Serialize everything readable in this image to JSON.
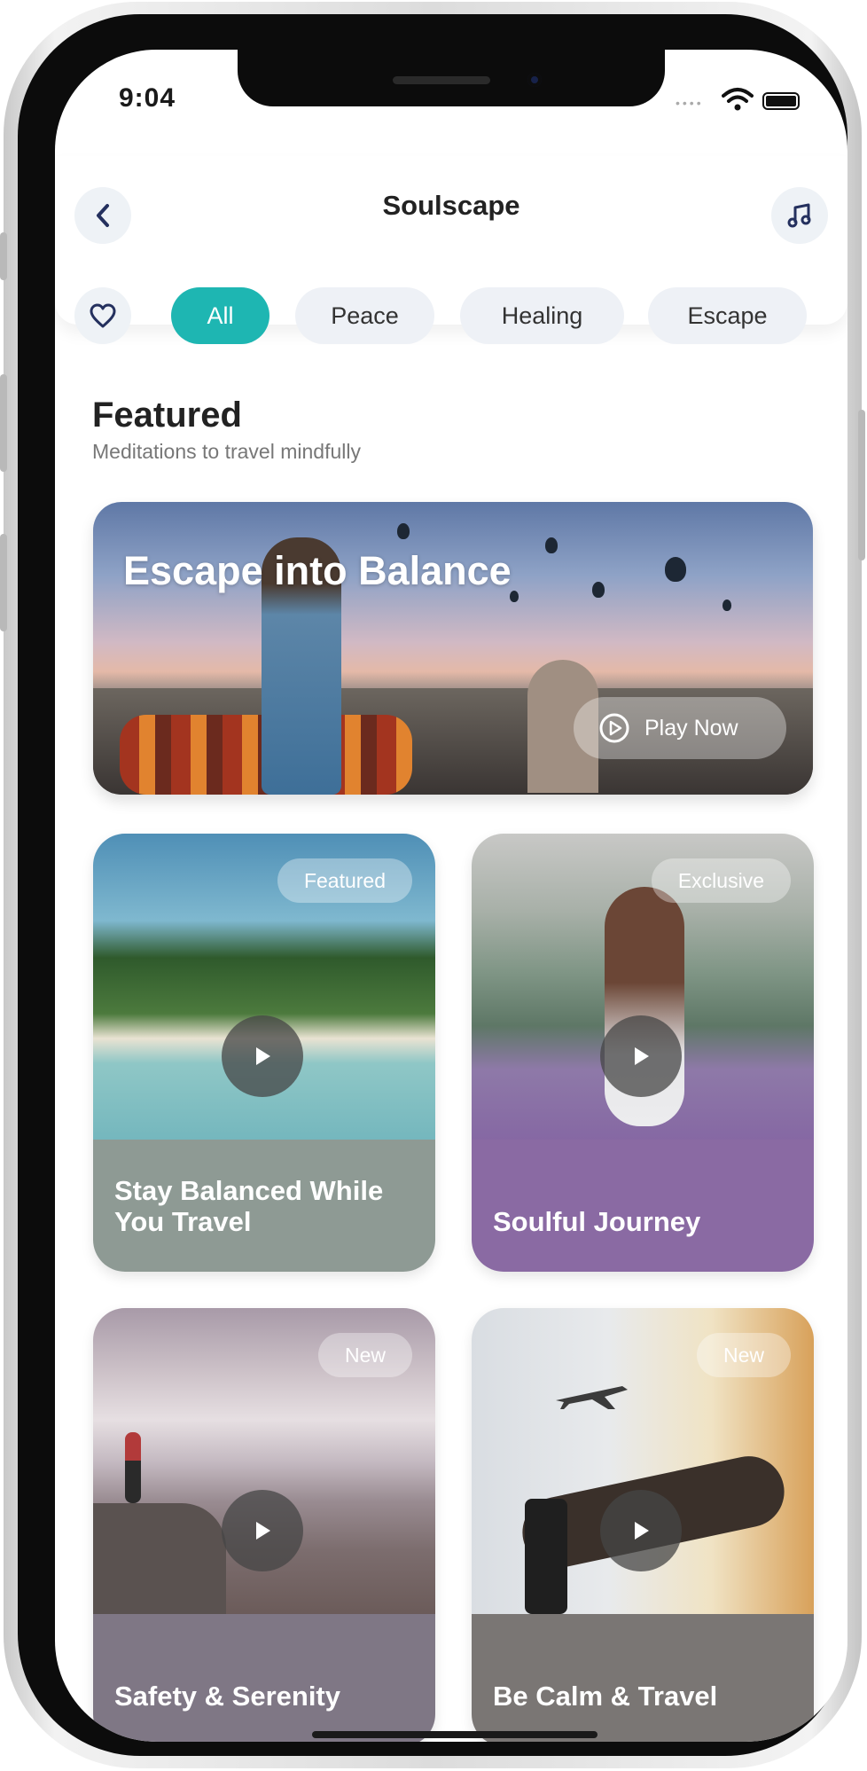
{
  "status": {
    "time": "9:04",
    "signal_dots": "••••"
  },
  "header": {
    "title": "Soulscape",
    "back_icon": "chevron-left-icon",
    "music_icon": "music-note-icon"
  },
  "filters": {
    "favorites_icon": "heart-icon",
    "chips": [
      "All",
      "Peace",
      "Healing",
      "Escape"
    ],
    "selected": "All",
    "accent": "#1eb6b2"
  },
  "section": {
    "title": "Featured",
    "subtitle": "Meditations to travel mindfully"
  },
  "hero": {
    "title": "Escape into Balance",
    "button": "Play Now"
  },
  "cards": [
    {
      "title": "Stay Balanced While You Travel",
      "badge": "Featured",
      "band_color": "#8e9a94"
    },
    {
      "title": "Soulful Journey",
      "badge": "Exclusive",
      "band_color": "#8a6aa3"
    },
    {
      "title": "Safety & Serenity",
      "badge": "New",
      "band_color": "#7f7785"
    },
    {
      "title": "Be Calm & Travel",
      "badge": "New",
      "band_color": "#7a7674"
    }
  ]
}
